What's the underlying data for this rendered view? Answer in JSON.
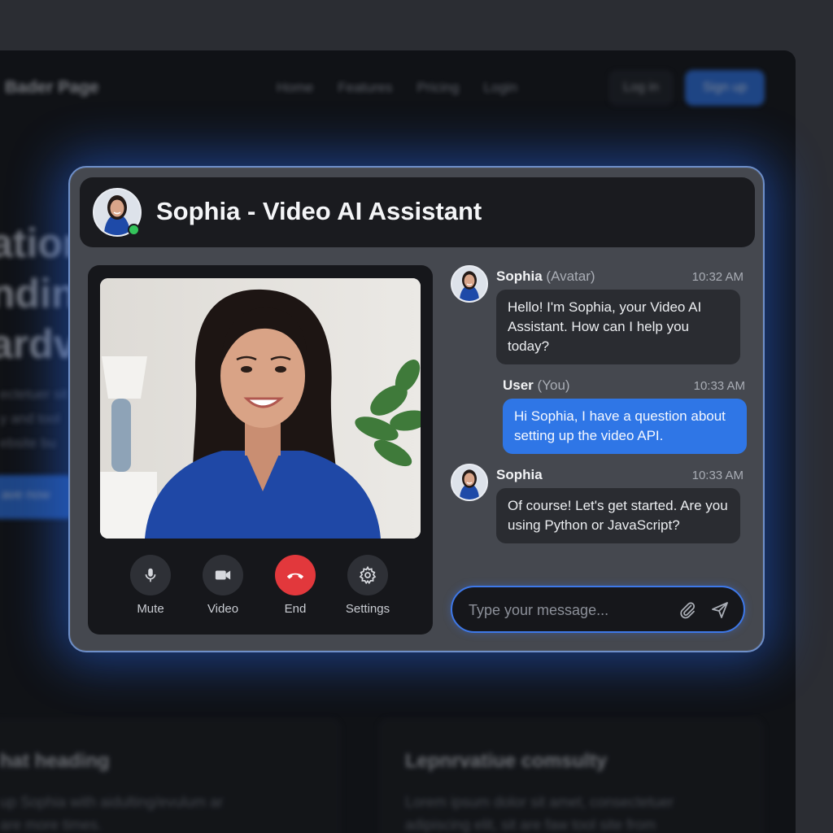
{
  "background": {
    "brand": "Bader Page",
    "nav_links": [
      "Home",
      "Features",
      "Pricing",
      "Login"
    ],
    "login_label": "Log in",
    "signup_label": "Sign up",
    "hero_lines": [
      "ation",
      "ndin",
      "ardv"
    ],
    "hero_sub": [
      "ectetuer sit",
      "y and tool",
      "ebsite bu"
    ],
    "cta_label": "ave now",
    "card_left": {
      "title": "hat heading",
      "body": [
        "up Sophia with aidulting/evulum ar",
        "are more times."
      ]
    },
    "card_right": {
      "title": "Lepnrvatiue comsulty",
      "body": [
        "Lorem ipsum dolor sit amet, consectetuer",
        "adipiscing elit, sit are faw tool site from"
      ]
    }
  },
  "header": {
    "title": "Sophia - Video AI Assistant",
    "status": "online"
  },
  "video": {
    "controls": [
      {
        "label": "Mute",
        "icon": "microphone-icon"
      },
      {
        "label": "Video",
        "icon": "camera-icon"
      },
      {
        "label": "End",
        "icon": "phone-hangup-icon"
      },
      {
        "label": "Settings",
        "icon": "gear-icon"
      }
    ]
  },
  "chat": {
    "messages": [
      {
        "sender": "Sophia",
        "role": "(Avatar)",
        "time": "10:32 AM",
        "text": "Hello! I'm Sophia, your Video AI Assistant. How can I help you today?"
      },
      {
        "sender": "User",
        "role": "(You)",
        "time": "10:33 AM",
        "text": "Hi Sophia, I have a question about setting up the video API."
      },
      {
        "sender": "Sophia",
        "role": "",
        "time": "10:33 AM",
        "text": "Of course! Let's get started. Are you using Python or JavaScript?"
      }
    ],
    "input": {
      "placeholder": "Type your message...",
      "value": ""
    }
  },
  "colors": {
    "accent": "#2f76e6",
    "end_call": "#e2383c",
    "online": "#34c45b"
  }
}
